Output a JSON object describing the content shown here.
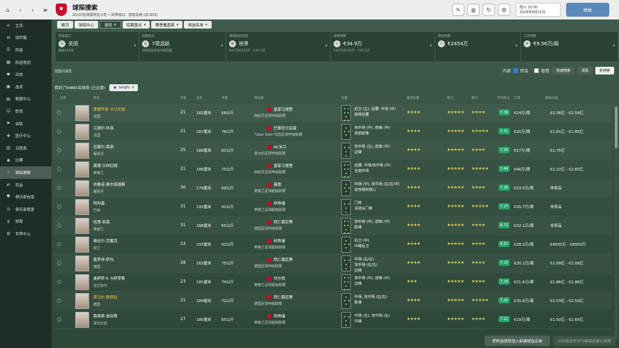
{
  "window": {
    "title": "球探搜索",
    "subtitle": "20/20名球探所在公司 • 世界知识：较有白用 (ID:605)",
    "date_line1": "周六 15:00",
    "date_line2": "2024年9月21日",
    "continue_label": "继续"
  },
  "sidebar": {
    "items": [
      {
        "label": "主页",
        "icon": "home-icon"
      },
      {
        "label": "收件箱",
        "icon": "inbox-icon"
      },
      {
        "label": "阵容",
        "icon": "squad-icon"
      },
      {
        "label": "阵容规划",
        "icon": "planner-icon"
      },
      {
        "label": "动态",
        "icon": "dynamics-icon"
      },
      {
        "label": "战术",
        "icon": "tactics-icon"
      },
      {
        "label": "数据中心",
        "icon": "data-icon"
      },
      {
        "label": "职员",
        "icon": "staff-icon"
      },
      {
        "label": "训练",
        "icon": "training-icon"
      },
      {
        "label": "医疗中心",
        "icon": "medical-icon"
      },
      {
        "label": "日程表",
        "icon": "calendar-icon"
      },
      {
        "label": "比赛",
        "icon": "match-icon"
      },
      {
        "label": "球探搜索",
        "icon": "scouting-icon"
      },
      {
        "label": "转会",
        "icon": "transfer-icon"
      },
      {
        "label": "俱乐部信息",
        "icon": "club-info-icon"
      },
      {
        "label": "俱乐部愿景",
        "icon": "vision-icon"
      },
      {
        "label": "财政",
        "icon": "finance-icon"
      },
      {
        "label": "世界中心",
        "icon": "world-icon"
      }
    ],
    "active_index": 12
  },
  "tabs": [
    {
      "label": "概况",
      "dropdown": false
    },
    {
      "label": "球探中心",
      "dropdown": false
    },
    {
      "label": "球员",
      "dropdown": true
    },
    {
      "label": "招募重点",
      "dropdown": true
    },
    {
      "label": "赛季覆盖面",
      "dropdown": true
    },
    {
      "label": "候选名单",
      "dropdown": true
    }
  ],
  "active_tab": 2,
  "filters": [
    {
      "label": "转会窗口",
      "value": "关闭",
      "sub": "剩余102天",
      "icon": "clock-icon"
    },
    {
      "label": "招募重点",
      "value": "7项活跃",
      "sub": "0项优先考虑/0项匹配",
      "icon": "target-icon"
    },
    {
      "label": "球探搜索范围",
      "value": "世界",
      "sub": "€42万/€225万 · €45.5万",
      "icon": "globe-icon"
    },
    {
      "label": "球探预算",
      "value": "€34.9万",
      "sub": "€42万/€225万 · €45.5万",
      "icon": "binoculars-icon"
    },
    {
      "label": "转会预算",
      "value": "€2454万",
      "sub": "",
      "icon": "wallet-icon"
    },
    {
      "label": "工资预算",
      "value": "€9.56万/周",
      "sub": "",
      "icon": "wage-icon"
    }
  ],
  "range_label": "范围内球员",
  "toolbar": {
    "internal_label": "内部",
    "transfer_label": "转会",
    "loan_label": "租借",
    "quick_search": "快速搜索",
    "clear": "清除",
    "new_search": "新搜索"
  },
  "found_text": "找到了54865名球员 (已过滤)",
  "filter_pill": "tangfu",
  "columns": {
    "info": "信息",
    "name": "姓名",
    "age": "年龄",
    "height": "身高",
    "weight": "体重",
    "club": "俱乐部",
    "position": "位置",
    "role": "最佳位置",
    "ca": "能力",
    "pa": "潜力",
    "rating": "平均评分",
    "wage": "工资",
    "value": "转会价值"
  },
  "players": [
    {
      "name": "爱德华多·卡马文加",
      "nat": "法国",
      "age": "21",
      "height": "182厘米",
      "weight": "68公斤",
      "club": "皇家马德里",
      "league": "西班牙足球甲级联赛",
      "pos": "后卫 (左), 后腰, 中场 (中)\n拖球后腰",
      "s1": "★★★★",
      "s2": "★★★★★",
      "s3": "★★★★",
      "rating": "7.36",
      "wage": "€24万/周",
      "value": "€2.36亿 - €2.59亿",
      "hl": true
    },
    {
      "name": "兰德尔·科洛",
      "nat": "法国",
      "age": "21",
      "height": "187厘米",
      "weight": "76公斤",
      "club": "巴黎圣日耳曼",
      "league": "\"Uber Eats\"法国足球甲级联赛",
      "pos": "攻中场 (中), 前锋 (中)\n突前前锋",
      "s1": "★★★★",
      "s2": "★★★★★",
      "s3": "★★★★★",
      "rating": "7.31",
      "wage": "€20万/周",
      "value": "€1.81亿 - €1.85亿",
      "hl": false
    },
    {
      "name": "拉斐尔·莱昂",
      "nat": "葡萄牙",
      "age": "25",
      "height": "188厘米",
      "weight": "81公斤",
      "club": "AC米兰",
      "league": "意大利足球甲级联赛",
      "pos": "攻中场 (左), 前锋 (中)\n边锋",
      "s1": "★★★★",
      "s2": "★★★★★",
      "s3": "★★★★",
      "rating": "7.20",
      "wage": "€17万/周",
      "value": "€1.75亿",
      "hl": false
    },
    {
      "name": "裘德·贝林厄姆",
      "nat": "英格兰",
      "age": "21",
      "height": "186厘米",
      "weight": "75公斤",
      "club": "皇家马德里",
      "league": "西班牙足球甲级联赛",
      "pos": "后腰, 中场/攻中场 (中)\n全能中场",
      "s1": "★★★★",
      "s2": "★★★★★",
      "s3": "★★★★★",
      "rating": "7.44",
      "wage": "€46万/周",
      "value": "€2.22亿 - €2.82亿",
      "hl": false
    },
    {
      "name": "布鲁诺·费尔南德斯",
      "nat": "葡萄牙",
      "age": "30",
      "height": "179厘米",
      "weight": "69公斤",
      "club": "曼联",
      "league": "英格兰足球超级联赛",
      "pos": "中场 (中), 攻中场 (右/左/中)\n进攻组织核心",
      "s1": "★★★★",
      "s2": "★★★★★",
      "s3": "★★★★",
      "rating": "7.26",
      "wage": "€33.5万/周",
      "value": "非卖品",
      "hl": false
    },
    {
      "name": "阿利森",
      "nat": "巴西",
      "age": "31",
      "height": "193厘米",
      "weight": "91公斤",
      "club": "利物浦",
      "league": "英格兰足球超级联赛",
      "pos": "门将\n清道夫门将",
      "s1": "★★★★",
      "s2": "★★★★★",
      "s3": "★★★★★",
      "rating": "7.27",
      "wage": "€35.7万/周",
      "value": "非卖品",
      "hl": false
    },
    {
      "name": "哈里·凯恩",
      "nat": "英格兰",
      "age": "31",
      "height": "188厘米",
      "weight": "65公斤",
      "club": "拜仁慕尼黑",
      "league": "德国足球甲级联赛",
      "pos": "攻中场 (中), 前锋 (中)\n影锋",
      "s1": "★★★★",
      "s2": "★★★★★",
      "s3": "★★★★",
      "rating": "6.72",
      "wage": "€32.1万/周",
      "value": "非卖品",
      "hl": false
    },
    {
      "name": "维吉尔·范戴克",
      "nat": "荷兰",
      "age": "33",
      "height": "193厘米",
      "weight": "92公斤",
      "club": "利物浦",
      "league": "英格兰足球超级联赛",
      "pos": "后卫 (中)\n中路后卫",
      "s1": "★★★★",
      "s2": "★★★★★",
      "s3": "★★★★",
      "rating": "6.87",
      "wage": "€28.3万/周",
      "value": "€4000万 - €8000万",
      "hl": false
    },
    {
      "name": "勒罗伊·萨内",
      "nat": "德国",
      "age": "28",
      "height": "183厘米",
      "weight": "75公斤",
      "club": "拜仁慕尼黑",
      "league": "德国足球甲级联赛",
      "pos": "中场 (右/左)\n攻中场 (右/左)\n边锋",
      "s1": "★★★★",
      "s2": "★★★★★",
      "s3": "★★★★",
      "rating": "7.15",
      "wage": "€20.1万/周",
      "value": "€1.09亿 - €1.09亿",
      "hl": false
    },
    {
      "name": "奥萨萨卡·卡萨罗斯",
      "nat": "拉达多尔",
      "age": "23",
      "height": "181厘米",
      "weight": "74公斤",
      "club": "切尔西",
      "league": "英格兰足球超级联赛",
      "pos": "攻中场 (中), 前锋 (中)\n边锋",
      "s1": "★★★",
      "s2": "★★★★★",
      "s3": "★★★★",
      "rating": "7.29",
      "wage": "€21.6万/周",
      "value": "€1.86亿 - €1.86亿",
      "hl": false
    },
    {
      "name": "贾马尔·穆西拉",
      "nat": "德国",
      "age": "21",
      "height": "184厘米",
      "weight": "72公斤",
      "club": "拜仁慕尼黑",
      "league": "德国足球甲级联赛",
      "pos": "中场, 攻中场 (右/左)\n影锋",
      "s1": "★★★★",
      "s2": "★★★★★",
      "s3": "★★★★★",
      "rating": "7.42",
      "wage": "€35.8万/周",
      "value": "€2.53亿 - €2.53亿",
      "hl": true
    },
    {
      "name": "路易斯·迪亚斯",
      "nat": "哥伦比亚",
      "age": "27",
      "height": "180厘米",
      "weight": "65公斤",
      "club": "利物浦",
      "league": "英格兰足球超级联赛",
      "pos": "中场 (左), 攻中场 (右)\n内锋",
      "s1": "★★★★",
      "s2": "★★★★★",
      "s3": "★★★★",
      "rating": "7.22",
      "wage": "€19万/周",
      "value": "€1.50亿 - €1.65亿",
      "hl": false
    }
  ],
  "footer": {
    "add_shortlist": "把所选球员加入新建候选名单",
    "add_filter": "以所选球员作为模版创建过滤器"
  }
}
